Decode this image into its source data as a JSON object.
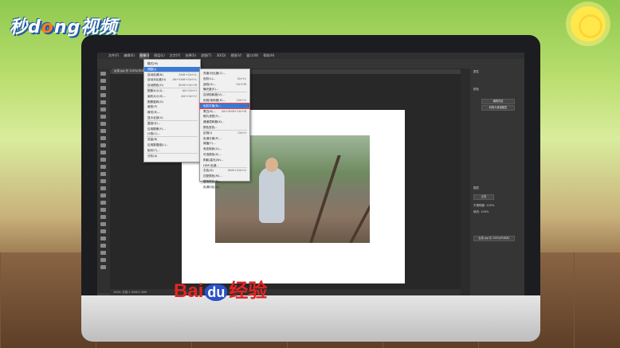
{
  "brand": {
    "text_a": "秒d",
    "text_b": "ng视频"
  },
  "footer": {
    "baidu_bai": "Bai",
    "baidu_du": "du",
    "jingyan": "经验"
  },
  "menubar": [
    "文件(F)",
    "编辑(E)",
    "图像(I)",
    "图层(L)",
    "文字(Y)",
    "选择(S)",
    "滤镜(T)",
    "3D(D)",
    "视图(V)",
    "窗口(W)",
    "帮助(H)"
  ],
  "doc_tab": "女孩.jpg @ 100%(RGB/8)",
  "image_menu": [
    {
      "label": "模式(M)",
      "shortcut": ""
    },
    {
      "label": "调整(J)",
      "shortcut": ""
    },
    {
      "label": "自动色调(N)",
      "shortcut": "Shift+Ctrl+L"
    },
    {
      "label": "自动对比度(U)",
      "shortcut": "Alt+Shift+Ctrl+L"
    },
    {
      "label": "自动颜色(O)",
      "shortcut": "Shift+Ctrl+B"
    },
    {
      "label": "图像大小(I)...",
      "shortcut": "Alt+Ctrl+I"
    },
    {
      "label": "画布大小(S)...",
      "shortcut": "Alt+Ctrl+C"
    },
    {
      "label": "图像旋转(G)",
      "shortcut": ""
    },
    {
      "label": "裁剪(P)",
      "shortcut": ""
    },
    {
      "label": "裁切(R)...",
      "shortcut": ""
    },
    {
      "label": "显示全部(V)",
      "shortcut": ""
    },
    {
      "label": "复制(D)...",
      "shortcut": ""
    },
    {
      "label": "应用图像(Y)...",
      "shortcut": ""
    },
    {
      "label": "计算(C)...",
      "shortcut": ""
    },
    {
      "label": "变量(B)",
      "shortcut": ""
    },
    {
      "label": "应用数据组(L)...",
      "shortcut": ""
    },
    {
      "label": "陷印(T)...",
      "shortcut": ""
    },
    {
      "label": "分析(A)",
      "shortcut": ""
    }
  ],
  "adjust_menu": [
    {
      "label": "亮度/对比度(C)...",
      "shortcut": ""
    },
    {
      "label": "色阶(L)...",
      "shortcut": "Ctrl+L"
    },
    {
      "label": "曲线(U)...",
      "shortcut": "Ctrl+M"
    },
    {
      "label": "曝光度(E)...",
      "shortcut": ""
    },
    {
      "label": "自然饱和度(V)...",
      "shortcut": ""
    },
    {
      "label": "色相/饱和度(H)...",
      "shortcut": "Ctrl+U"
    },
    {
      "label": "色彩平衡(B)...",
      "shortcut": "Ctrl+B"
    },
    {
      "label": "黑白(K)...",
      "shortcut": "Alt+Shift+Ctrl+B"
    },
    {
      "label": "照片滤镜(F)...",
      "shortcut": ""
    },
    {
      "label": "通道混和器(X)...",
      "shortcut": ""
    },
    {
      "label": "颜色查找...",
      "shortcut": ""
    },
    {
      "label": "反相(I)",
      "shortcut": "Ctrl+I"
    },
    {
      "label": "色调分离(P)...",
      "shortcut": ""
    },
    {
      "label": "阈值(T)...",
      "shortcut": ""
    },
    {
      "label": "渐变映射(G)...",
      "shortcut": ""
    },
    {
      "label": "可选颜色(S)...",
      "shortcut": ""
    },
    {
      "label": "阴影/高光(W)...",
      "shortcut": ""
    },
    {
      "label": "HDR 色调...",
      "shortcut": ""
    },
    {
      "label": "去色(D)",
      "shortcut": "Shift+Ctrl+U"
    },
    {
      "label": "匹配颜色(M)...",
      "shortcut": ""
    },
    {
      "label": "替换颜色(R)...",
      "shortcut": ""
    },
    {
      "label": "色调均化(Q)",
      "shortcut": ""
    }
  ],
  "right_panel": {
    "props_title": "属性",
    "swatch_label": "颜色",
    "layer_label": "图层",
    "btn_1": "编辑内容",
    "btn_2": "转换为普通图层",
    "mode_label": "正常",
    "opacity": "不透明度: 100%",
    "fill": "填充: 100%"
  },
  "status": "100%  文档:1.05M/1.05M"
}
